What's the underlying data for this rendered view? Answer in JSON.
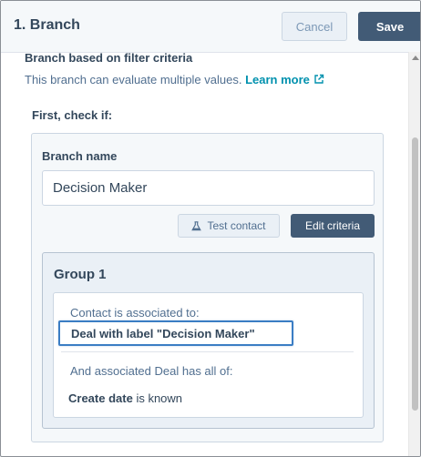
{
  "header": {
    "title": "1. Branch",
    "cancel_label": "Cancel",
    "save_label": "Save"
  },
  "section": {
    "heading": "Branch based on filter criteria",
    "description": "This branch can evaluate multiple values.",
    "learn_more_label": "Learn more",
    "first_check_label": "First, check if:"
  },
  "branch": {
    "name_label": "Branch name",
    "name_value": "Decision Maker",
    "test_contact_label": "Test contact",
    "edit_criteria_label": "Edit criteria"
  },
  "group": {
    "title": "Group 1",
    "association_text": "Contact is associated to:",
    "deal_label": "Deal with label \"Decision Maker\"",
    "and_text": "And associated Deal has all of:",
    "condition_property": "Create date",
    "condition_operator": "is known"
  },
  "icons": {
    "external_link": "external-link-icon",
    "flask": "flask-icon"
  },
  "colors": {
    "primary_button": "#425b76",
    "link": "#0091ae",
    "highlight_border": "#3b7dc4"
  }
}
